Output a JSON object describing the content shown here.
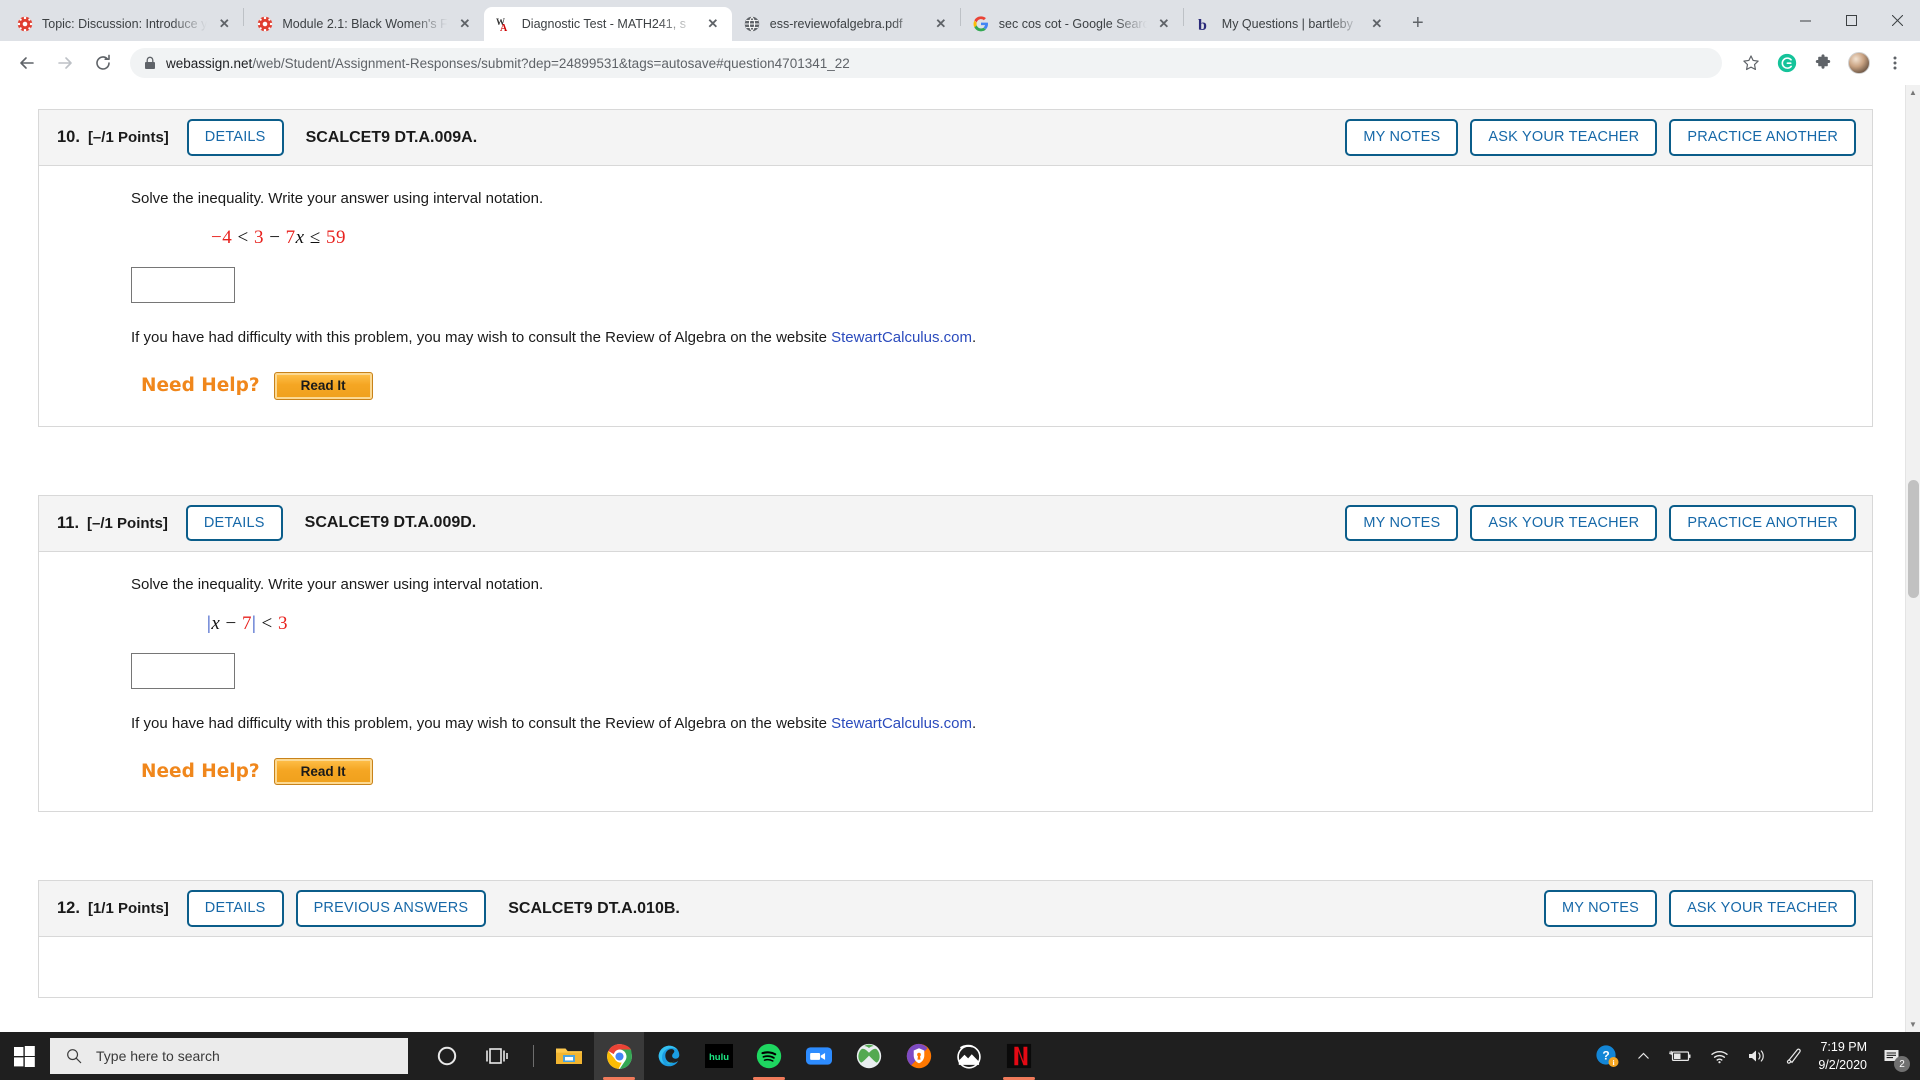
{
  "browser": {
    "tabs": [
      {
        "title": "Topic: Discussion: Introduce y",
        "favicon": "canvas-lms",
        "active": false,
        "close_label": "✕"
      },
      {
        "title": "Module 2.1: Black Women's F",
        "favicon": "canvas-lms",
        "active": false,
        "close_label": "✕"
      },
      {
        "title": "Diagnostic Test - MATH241, s",
        "favicon": "webassign",
        "active": true,
        "close_label": "✕"
      },
      {
        "title": "ess-reviewofalgebra.pdf",
        "favicon": "globe-pdf",
        "active": false,
        "close_label": "✕"
      },
      {
        "title": "sec cos cot - Google Search",
        "favicon": "google",
        "active": false,
        "close_label": "✕"
      },
      {
        "title": "My Questions | bartleby",
        "favicon": "bartleby",
        "active": false,
        "close_label": "✕"
      }
    ],
    "new_tab_label": "+",
    "window_controls": {
      "minimize": "–",
      "maximize": "❐",
      "close": "✕"
    },
    "nav": {
      "back": "←",
      "forward": "→",
      "reload": "⟳"
    },
    "omnibox": {
      "host": "webassign.net",
      "path": "/web/Student/Assignment-Responses/submit?dep=24899531&tags=autosave#question4701341_22",
      "full_url": "webassign.net/web/Student/Assignment-Responses/submit?dep=24899531&tags=autosave#question4701341_22"
    },
    "toolbar_icons": [
      {
        "name": "bookmark-star-icon",
        "glyph": "☆"
      },
      {
        "name": "grammarly-extension-icon",
        "glyph": "G"
      },
      {
        "name": "extensions-puzzle-icon",
        "glyph": "❖"
      },
      {
        "name": "profile-avatar",
        "glyph": ""
      },
      {
        "name": "chrome-menu-icon",
        "glyph": "⋮"
      }
    ]
  },
  "page": {
    "questions": [
      {
        "number": "10.",
        "points": "[–/1 Points]",
        "details_label": "DETAILS",
        "code": "SCALCET9 DT.A.009A.",
        "right_buttons": [
          "MY NOTES",
          "ASK YOUR TEACHER",
          "PRACTICE ANOTHER"
        ],
        "prompt": "Solve the inequality. Write your answer using interval notation.",
        "math": {
          "parts": [
            {
              "t": "−4",
              "c": "num"
            },
            {
              "t": " < ",
              "c": "op"
            },
            {
              "t": "3",
              "c": "num"
            },
            {
              "t": " − ",
              "c": "op"
            },
            {
              "t": "7",
              "c": "num"
            },
            {
              "t": "x",
              "c": "var"
            },
            {
              "t": " ≤ ",
              "c": "op"
            },
            {
              "t": "59",
              "c": "num"
            }
          ],
          "plain": "−4 < 3 − 7x ≤ 59"
        },
        "answer_value": "",
        "help_text_before": "If you have had difficulty with this problem, you may wish to consult the Review of Algebra on the website ",
        "help_link": "StewartCalculus.com",
        "help_text_after": ".",
        "need_help_label": "Need Help?",
        "read_it_label": "Read It"
      },
      {
        "number": "11.",
        "points": "[–/1 Points]",
        "details_label": "DETAILS",
        "code": "SCALCET9 DT.A.009D.",
        "right_buttons": [
          "MY NOTES",
          "ASK YOUR TEACHER",
          "PRACTICE ANOTHER"
        ],
        "prompt": "Solve the inequality. Write your answer using interval notation.",
        "math": {
          "parts": [
            {
              "t": "|",
              "c": "bar"
            },
            {
              "t": "x",
              "c": "var"
            },
            {
              "t": " − ",
              "c": "op"
            },
            {
              "t": "7",
              "c": "num"
            },
            {
              "t": "|",
              "c": "bar"
            },
            {
              "t": " < ",
              "c": "op"
            },
            {
              "t": "3",
              "c": "num"
            }
          ],
          "plain": "|x − 7| < 3"
        },
        "answer_value": "",
        "help_text_before": "If you have had difficulty with this problem, you may wish to consult the Review of Algebra on the website ",
        "help_link": "StewartCalculus.com",
        "help_text_after": ".",
        "need_help_label": "Need Help?",
        "read_it_label": "Read It"
      }
    ],
    "question12": {
      "number": "12.",
      "points": "[1/1 Points]",
      "details_label": "DETAILS",
      "previous_answers_label": "PREVIOUS ANSWERS",
      "code": "SCALCET9 DT.A.010B.",
      "right_buttons": [
        "MY NOTES",
        "ASK YOUR TEACHER"
      ]
    }
  },
  "taskbar": {
    "start_label": "Start",
    "search_placeholder": "Type here to search",
    "apps": [
      {
        "name": "cortana-icon"
      },
      {
        "name": "task-view-icon"
      },
      {
        "name": "file-explorer-icon"
      },
      {
        "name": "google-chrome-icon",
        "active": true,
        "running": true
      },
      {
        "name": "microsoft-edge-icon"
      },
      {
        "name": "hulu-icon",
        "label": "hulu"
      },
      {
        "name": "spotify-icon",
        "running": true
      },
      {
        "name": "zoom-icon"
      },
      {
        "name": "xbox-icon"
      },
      {
        "name": "avast-icon"
      },
      {
        "name": "photos-icon"
      },
      {
        "name": "netflix-icon",
        "label": "N",
        "running": true
      }
    ],
    "tray": {
      "help_icon": "?",
      "show_hidden": "⌃",
      "battery": "battery-charging-icon",
      "wifi": "wifi-icon",
      "volume": "volume-icon",
      "pen": "pen-icon",
      "time": "7:19 PM",
      "date": "9/2/2020",
      "notification_count": "2"
    }
  },
  "colors": {
    "accent_blue": "#0b5d8a",
    "link_blue": "#2b4bbd",
    "math_red": "#e8231f",
    "need_help_orange": "#f0871c",
    "read_it_yellow": "#f5a623",
    "tab_strip": "#dee1e6",
    "taskbar": "#1f1f1f"
  }
}
